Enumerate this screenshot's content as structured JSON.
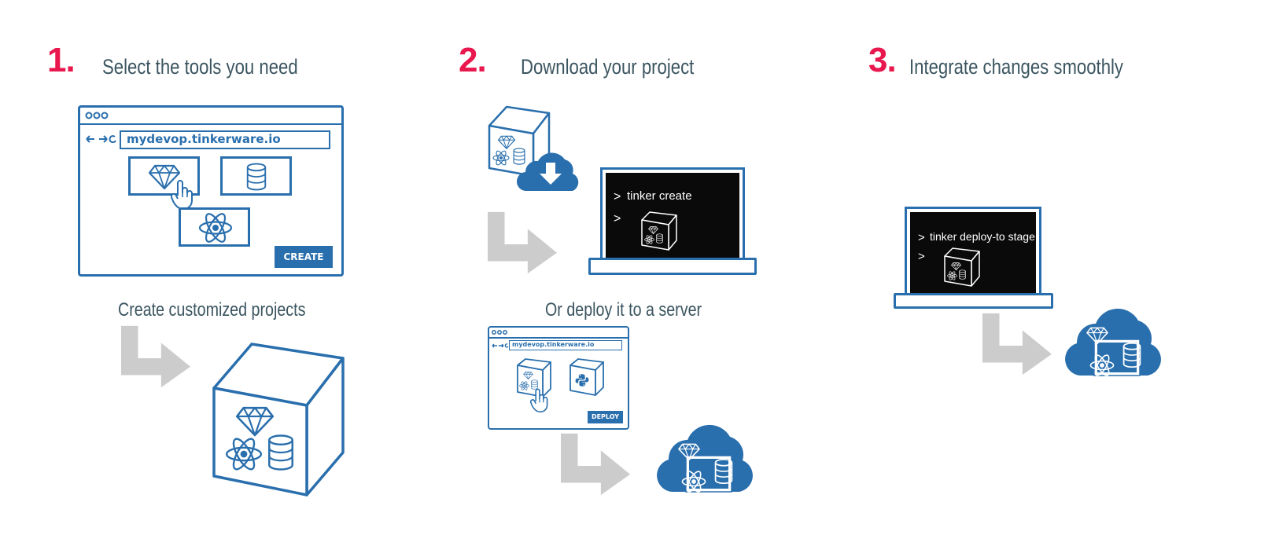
{
  "step1": {
    "number": "1.",
    "title": "Select the tools you need",
    "url": "mydevop.tinkerware.io",
    "create_button": "CREATE",
    "subtitle": "Create customized projects"
  },
  "step2": {
    "number": "2.",
    "title": "Download your project",
    "terminal_command": "tinker create",
    "prompt_symbol": ">",
    "subtitle": "Or deploy it to a server",
    "url": "mydevop.tinkerware.io",
    "deploy_button": "DEPLOY"
  },
  "step3": {
    "number": "3.",
    "title": "Integrate changes smoothly",
    "terminal_command": "tinker deploy-to stage",
    "prompt_symbol": ">"
  },
  "colors": {
    "accent_red": "#e8174d",
    "brand_blue": "#2a6fad",
    "heading_gray": "#3b5560",
    "arrow_gray": "#cccccc",
    "terminal_bg": "#0a0a0a"
  },
  "icons": [
    "gem-icon",
    "database-icon",
    "react-atom-icon",
    "python-icon",
    "cloud-download-icon",
    "cloud-icon",
    "hand-pointer-icon",
    "package-cube-icon",
    "laptop-icon",
    "arrow-icon"
  ]
}
